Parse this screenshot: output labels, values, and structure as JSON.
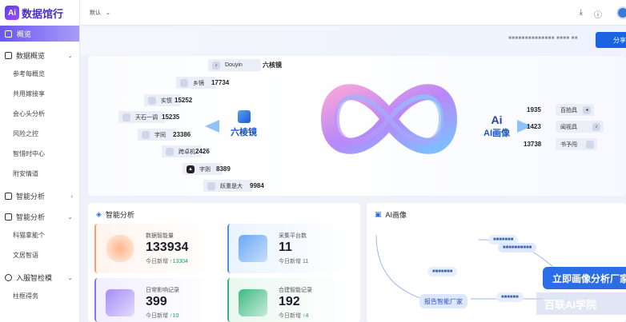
{
  "app": {
    "logo_mark": "Ai",
    "logo_text": "数据馆行"
  },
  "sidebar": {
    "active": "概览",
    "groups": [
      {
        "label": "数据概览",
        "items": [
          "参考每概览",
          "共用嫁接享",
          "会心头分析",
          "风险之控",
          "智惜时中心",
          "附安情道"
        ]
      },
      {
        "label": "智能分析",
        "items": []
      },
      {
        "label": "智能分析",
        "items": [
          "科猫拿能个",
          "文居智语"
        ]
      },
      {
        "label": "入服智检模",
        "items": [
          "柱框得务"
        ]
      }
    ]
  },
  "topbar": {
    "env_label": "默认",
    "download_icon": "download-icon",
    "info_icon": "info-icon"
  },
  "subbar": {
    "text": "■■■■■■■■■■■■■■ ■■■■ ■■",
    "share_label": "分享"
  },
  "hero": {
    "left_chips": [
      {
        "name": "Douyin",
        "value": "六核镜"
      },
      {
        "name": "乡镜",
        "value": "17734"
      },
      {
        "name": "实惯",
        "value": "15252"
      },
      {
        "name": "天石一调",
        "value": "15235"
      },
      {
        "name": "字同",
        "value": "23386"
      },
      {
        "name": "跨卓机",
        "value": "2426"
      },
      {
        "name": "字则",
        "value": "8389"
      },
      {
        "name": "跃重是大",
        "value": "9984"
      }
    ],
    "left_brand": "六棱镜",
    "right_brand_mark": "Ai",
    "right_brand": "AI画像",
    "right_chips": [
      {
        "value": "1935",
        "name": "百拍具"
      },
      {
        "value": "1423",
        "name": "闻视具"
      },
      {
        "value": "13738",
        "name": "书予闯"
      }
    ]
  },
  "smart": {
    "title": "智能分析",
    "stats": [
      {
        "label": "数据智能量",
        "value": "133934",
        "sub": "今日新增",
        "delta": "↑13304"
      },
      {
        "label": "采集平台数",
        "value": "11",
        "sub": "今日新增",
        "delta": "11"
      },
      {
        "label": "日常影响记录",
        "value": "399",
        "sub": "今日新增",
        "delta": "↑10"
      },
      {
        "label": "合建智能记录",
        "value": "192",
        "sub": "今日新增",
        "delta": "↑4"
      }
    ]
  },
  "portrait": {
    "title": "AI画像",
    "tags": [
      "■■■■■■■",
      "■■■■■■■■■■",
      "■■■■■■■",
      "报告智能厂家",
      "■■■■■■"
    ],
    "cta": "立即画像分析厂家",
    "watermark": "百联AI学院"
  },
  "colors": {
    "accent": "#1b63e0",
    "brand": "#5b3cf6"
  }
}
